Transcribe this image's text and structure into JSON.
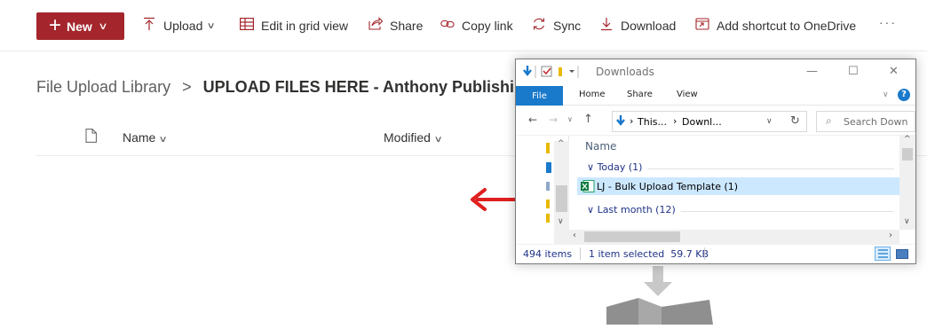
{
  "toolbar": {
    "new_label": "New",
    "upload_label": "Upload",
    "grid_label": "Edit in grid view",
    "share_label": "Share",
    "copylink_label": "Copy link",
    "sync_label": "Sync",
    "download_label": "Download",
    "shortcut_label": "Add shortcut to OneDrive",
    "more_label": "···"
  },
  "breadcrumb": {
    "parent": "File Upload Library",
    "separator": ">",
    "current": "UPLOAD FILES HERE - Anthony Publishing"
  },
  "columns": {
    "name": "Name",
    "modified": "Modified"
  },
  "explorer": {
    "title": "Downloads",
    "tabs": [
      "File",
      "Home",
      "Share",
      "View"
    ],
    "address": "This... › Downl...",
    "address_root": "This...",
    "address_leaf": "Downl...",
    "search_placeholder": "Search Down",
    "column_name": "Name",
    "group_today": "Today (1)",
    "file_name": "LJ - Bulk Upload Template (1)",
    "group_lastmonth": "Last month (12)",
    "item_count": "494 items",
    "selection": "1 item selected  59.7 KB"
  },
  "colors": {
    "brand": "#a4262c",
    "explorer_accent": "#1979ca",
    "selection": "#cce8ff",
    "arrow": "#e02020"
  }
}
